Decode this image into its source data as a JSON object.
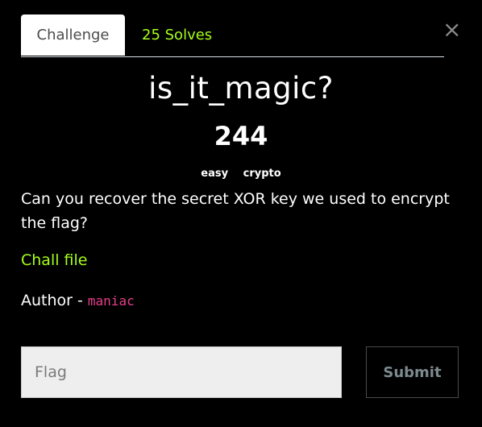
{
  "tabs": {
    "challenge_label": "Challenge",
    "solves_label": "25 Solves"
  },
  "close_icon": "×",
  "challenge": {
    "name": "is_it_magic?",
    "value": "244",
    "tags": [
      "easy",
      "crypto"
    ],
    "description": "Can you recover the secret XOR key we used to encrypt the flag?",
    "file_link": "Chall file",
    "author_prefix": "Author - ",
    "author_name": "maniac"
  },
  "form": {
    "flag_placeholder": "Flag",
    "submit_label": "Submit"
  },
  "colors": {
    "accent": "#a6ff1a",
    "author_code": "#e83e8c",
    "background": "#000000"
  }
}
